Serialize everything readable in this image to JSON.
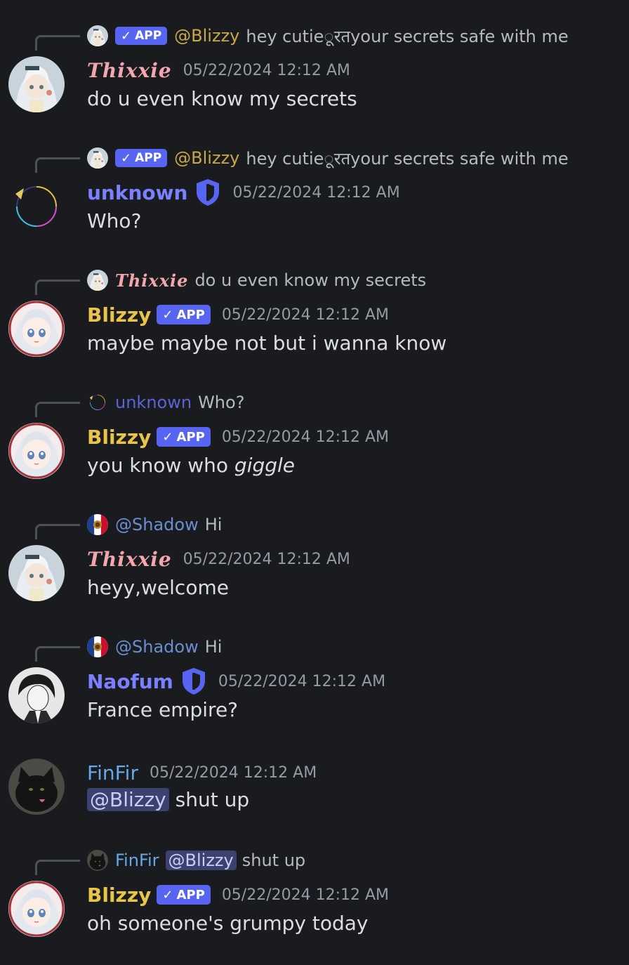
{
  "colors": {
    "background": "#1a1b1e",
    "text": "#dbdee1",
    "muted": "#949ba4",
    "app_tag": "#5865f2",
    "mention_bg": "#3c4270"
  },
  "messages": [
    {
      "reply": {
        "badge": "APP",
        "mention": "@Blizzy",
        "text": "hey cutieूरतyour secrets safe with me",
        "avatar_icon": "anime-girl-avatar-icon"
      },
      "author": "Thixxie",
      "timestamp": "05/22/2024 12:12 AM",
      "text": "do u even know my secrets",
      "avatar_icon": "anime-girl-avatar-icon"
    },
    {
      "reply": {
        "badge": "APP",
        "mention": "@Blizzy",
        "text": "hey cutieूरतyour secrets safe with me",
        "avatar_icon": "anime-girl-avatar-icon"
      },
      "author": "unknown",
      "timestamp": "05/22/2024 12:12 AM",
      "text": "Who?",
      "avatar_icon": "ring-avatar-icon"
    },
    {
      "reply": {
        "name": "Thixxie",
        "text": "do u even know my secrets",
        "avatar_icon": "anime-girl-avatar-icon"
      },
      "author": "Blizzy",
      "badge": "APP",
      "timestamp": "05/22/2024 12:12 AM",
      "text": "maybe maybe not but i wanna know",
      "avatar_icon": "white-hair-girl-avatar-icon"
    },
    {
      "reply": {
        "name": "unknown",
        "text": "Who?",
        "avatar_icon": "ring-avatar-icon"
      },
      "author": "Blizzy",
      "badge": "APP",
      "timestamp": "05/22/2024 12:12 AM",
      "text_plain": "you know who ",
      "text_italic": "giggle",
      "avatar_icon": "white-hair-girl-avatar-icon"
    },
    {
      "reply": {
        "name": "@Shadow",
        "text": "Hi",
        "avatar_icon": "flag-emblem-avatar-icon"
      },
      "author": "Thixxie",
      "timestamp": "05/22/2024 12:12 AM",
      "text": "heyy,welcome",
      "avatar_icon": "anime-girl-avatar-icon"
    },
    {
      "reply": {
        "name": "@Shadow",
        "text": "Hi",
        "avatar_icon": "flag-emblem-avatar-icon"
      },
      "author": "Naofum",
      "timestamp": "05/22/2024 12:12 AM",
      "text": "France empire?",
      "avatar_icon": "manga-man-avatar-icon"
    },
    {
      "author": "FinFir",
      "timestamp": "05/22/2024 12:12 AM",
      "mention": "@Blizzy",
      "text": " shut up",
      "avatar_icon": "black-cat-avatar-icon"
    },
    {
      "reply": {
        "name": "FinFir",
        "mention": "@Blizzy",
        "text": "shut up",
        "avatar_icon": "black-cat-avatar-icon"
      },
      "author": "Blizzy",
      "badge": "APP",
      "timestamp": "05/22/2024 12:12 AM",
      "text": "oh someone's grumpy today",
      "avatar_icon": "white-hair-girl-avatar-icon"
    }
  ]
}
